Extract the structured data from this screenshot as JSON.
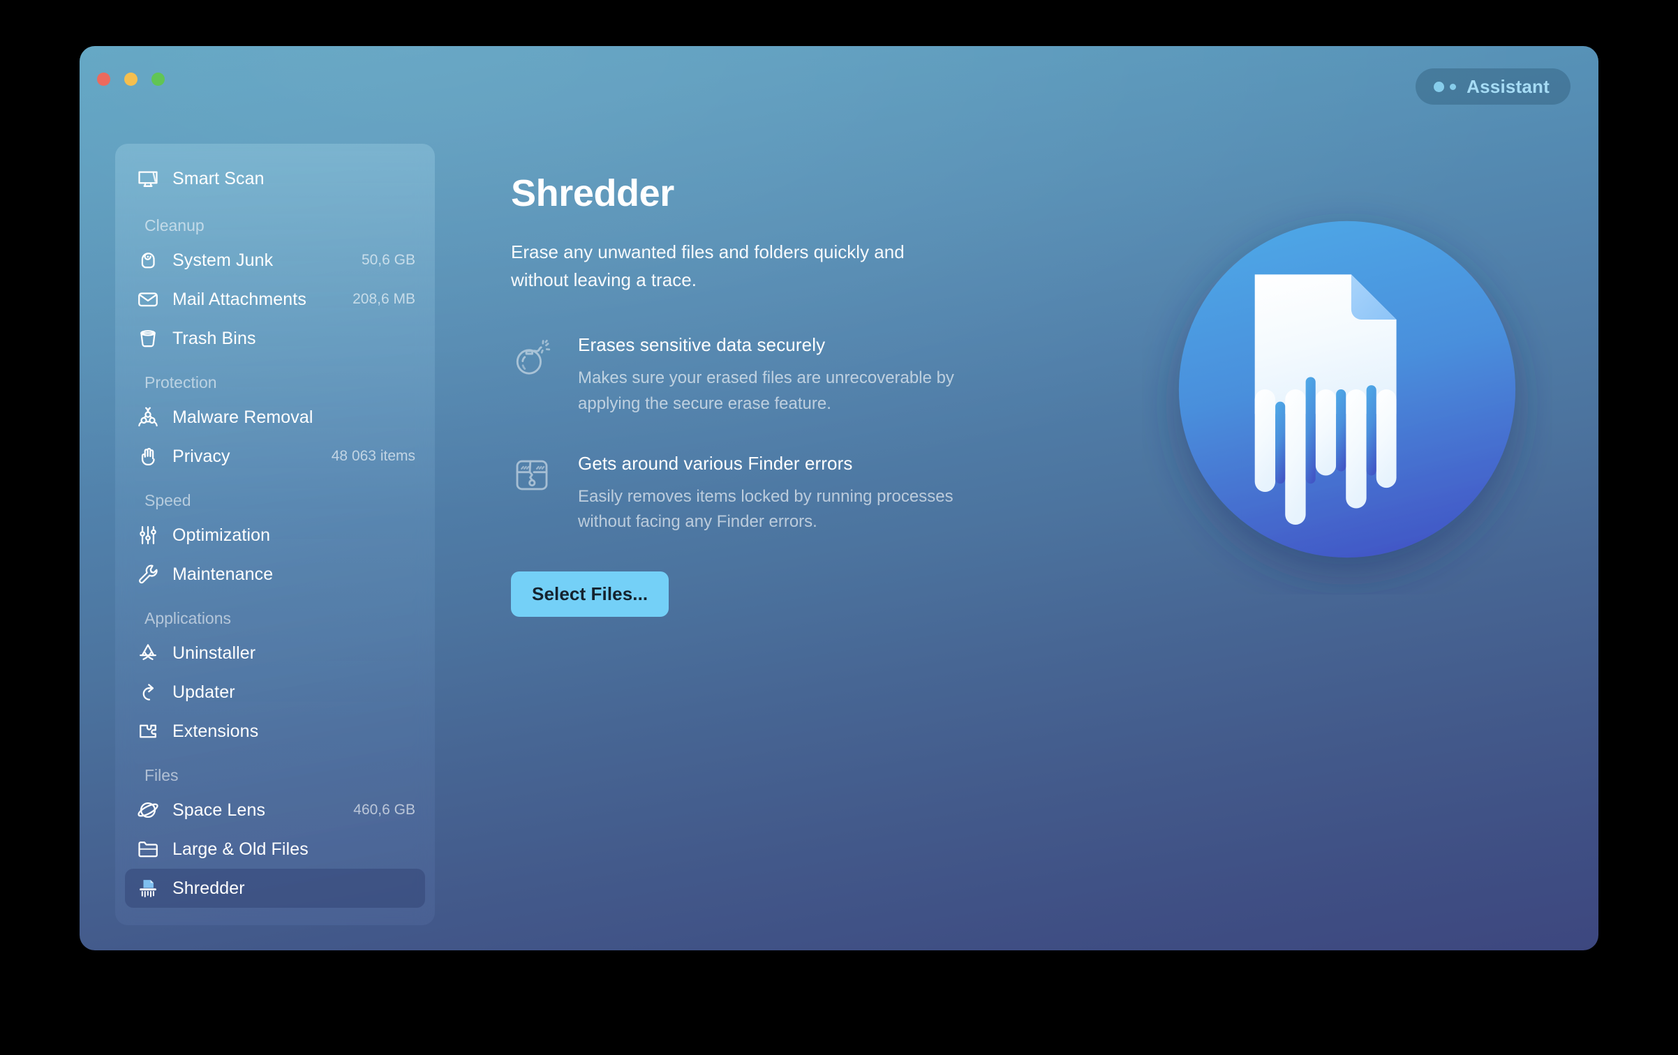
{
  "window": {
    "traffic_lights": [
      "close",
      "minimize",
      "zoom"
    ],
    "assistant": {
      "label": "Assistant"
    }
  },
  "sidebar": {
    "items": [
      {
        "id": "smart-scan",
        "label": "Smart Scan",
        "value": "",
        "icon": "monitor-icon",
        "selected": false,
        "type": "item"
      },
      {
        "id": "cleanup",
        "label": "Cleanup",
        "value": "",
        "icon": "",
        "selected": false,
        "type": "section"
      },
      {
        "id": "system-junk",
        "label": "System Junk",
        "value": "50,6 GB",
        "icon": "broom-icon",
        "selected": false,
        "type": "item"
      },
      {
        "id": "mail-attachments",
        "label": "Mail Attachments",
        "value": "208,6 MB",
        "icon": "envelope-icon",
        "selected": false,
        "type": "item"
      },
      {
        "id": "trash-bins",
        "label": "Trash Bins",
        "value": "",
        "icon": "trash-icon",
        "selected": false,
        "type": "item"
      },
      {
        "id": "protection",
        "label": "Protection",
        "value": "",
        "icon": "",
        "selected": false,
        "type": "section"
      },
      {
        "id": "malware-removal",
        "label": "Malware Removal",
        "value": "",
        "icon": "biohazard-icon",
        "selected": false,
        "type": "item"
      },
      {
        "id": "privacy",
        "label": "Privacy",
        "value": "48 063 items",
        "icon": "hand-icon",
        "selected": false,
        "type": "item"
      },
      {
        "id": "speed",
        "label": "Speed",
        "value": "",
        "icon": "",
        "selected": false,
        "type": "section"
      },
      {
        "id": "optimization",
        "label": "Optimization",
        "value": "",
        "icon": "sliders-icon",
        "selected": false,
        "type": "item"
      },
      {
        "id": "maintenance",
        "label": "Maintenance",
        "value": "",
        "icon": "wrench-icon",
        "selected": false,
        "type": "item"
      },
      {
        "id": "applications",
        "label": "Applications",
        "value": "",
        "icon": "",
        "selected": false,
        "type": "section"
      },
      {
        "id": "uninstaller",
        "label": "Uninstaller",
        "value": "",
        "icon": "appstore-icon",
        "selected": false,
        "type": "item"
      },
      {
        "id": "updater",
        "label": "Updater",
        "value": "",
        "icon": "arrow-up-icon",
        "selected": false,
        "type": "item"
      },
      {
        "id": "extensions",
        "label": "Extensions",
        "value": "",
        "icon": "puzzle-icon",
        "selected": false,
        "type": "item"
      },
      {
        "id": "files",
        "label": "Files",
        "value": "",
        "icon": "",
        "selected": false,
        "type": "section"
      },
      {
        "id": "space-lens",
        "label": "Space Lens",
        "value": "460,6 GB",
        "icon": "planet-icon",
        "selected": false,
        "type": "item"
      },
      {
        "id": "large-old-files",
        "label": "Large & Old Files",
        "value": "",
        "icon": "folder-icon",
        "selected": false,
        "type": "item"
      },
      {
        "id": "shredder",
        "label": "Shredder",
        "value": "",
        "icon": "shredder-icon",
        "selected": true,
        "type": "item"
      }
    ]
  },
  "main": {
    "title": "Shredder",
    "subtitle": "Erase any unwanted files and folders quickly and without leaving a trace.",
    "features": [
      {
        "icon": "bomb-icon",
        "title": "Erases sensitive data securely",
        "desc": "Makes sure your erased files are unrecoverable by applying the secure erase feature."
      },
      {
        "icon": "broken-box-icon",
        "title": "Gets around various Finder errors",
        "desc": "Easily removes items locked by running processes without facing any Finder errors."
      }
    ],
    "select_files_label": "Select Files...",
    "hero_icon": "shredded-document-icon"
  },
  "colors": {
    "window_top": "#5ba2c1",
    "window_bottom": "#3d477f",
    "accent_button": "#74d0f7",
    "assistant_text": "#a6dcf5",
    "selected_row": "#4e5a82",
    "hero_circle_top": "#4a9fe0",
    "hero_circle_bottom": "#4258c4",
    "traffic_close": "#ec6a5e",
    "traffic_minimize": "#f5bf4f",
    "traffic_zoom": "#61c554"
  }
}
